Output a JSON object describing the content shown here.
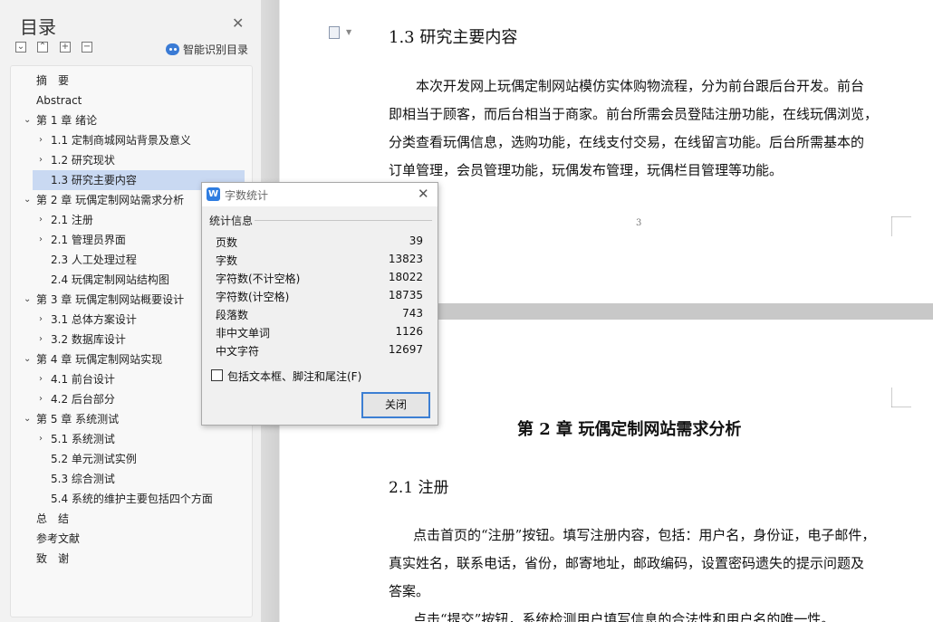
{
  "toc": {
    "title": "目录",
    "smart_label": "智能识别目录",
    "toolbar": [
      "⌄",
      "⌃",
      "+",
      "−"
    ],
    "items": [
      {
        "label": "摘　要",
        "caret": ""
      },
      {
        "label": "Abstract",
        "caret": ""
      },
      {
        "label": "第 1 章  绪论",
        "caret": "⌄"
      },
      {
        "label": "1.1  定制商城网站背景及意义",
        "caret": "›"
      },
      {
        "label": "1.2 研究现状",
        "caret": "›"
      },
      {
        "label": "1.3  研究主要内容",
        "caret": ""
      },
      {
        "label": "第 2 章  玩偶定制网站需求分析",
        "caret": "⌄"
      },
      {
        "label": "2.1 注册",
        "caret": "›"
      },
      {
        "label": "2.1 管理员界面",
        "caret": "›"
      },
      {
        "label": "2.3 人工处理过程",
        "caret": ""
      },
      {
        "label": "2.4 玩偶定制网站结构图",
        "caret": ""
      },
      {
        "label": "第 3 章  玩偶定制网站概要设计",
        "caret": "⌄"
      },
      {
        "label": "3.1 总体方案设计",
        "caret": "›"
      },
      {
        "label": "3.2  数据库设计",
        "caret": "›"
      },
      {
        "label": "第 4 章  玩偶定制网站实现",
        "caret": "⌄"
      },
      {
        "label": "4.1  前台设计",
        "caret": "›"
      },
      {
        "label": "4.2  后台部分",
        "caret": "›"
      },
      {
        "label": "第 5 章  系统测试",
        "caret": "⌄"
      },
      {
        "label": "5.1 系统测试",
        "caret": "›"
      },
      {
        "label": "5.2 单元测试实例",
        "caret": ""
      },
      {
        "label": "5.3 综合测试",
        "caret": ""
      },
      {
        "label": "5.4 系统的维护主要包括四个方面",
        "caret": ""
      },
      {
        "label": "总　结",
        "caret": ""
      },
      {
        "label": "参考文献",
        "caret": ""
      },
      {
        "label": "致　谢",
        "caret": ""
      }
    ]
  },
  "document": {
    "page1": {
      "heading": "1.3  研究主要内容",
      "lines": [
        "本次开发网上玩偶定制网站模仿实体购物流程，分为前台跟后台开发。前台",
        "即相当于顾客，而后台相当于商家。前台所需会员登陆注册功能，在线玩偶浏览，",
        "分类查看玩偶信息，选购功能，在线支付交易，在线留言功能。后台所需基本的",
        "订单管理，会员管理功能，玩偶发布管理，玩偶栏目管理等功能。"
      ],
      "page_number": "3"
    },
    "page2": {
      "chapter": "第 2 章  玩偶定制网站需求分析",
      "section": "2.1 注册",
      "lines": [
        "点击首页的“注册”按钮。填写注册内容，包括：用户名，身份证，电子邮件，",
        "真实姓名，联系电话，省份，邮寄地址，邮政编码，设置密码遗失的提示问题及",
        "答案。",
        "点击“提交”按钮，系统检测用户填写信息的合法性和用户名的唯一性。"
      ]
    }
  },
  "dialog": {
    "title": "字数统计",
    "section_label": "统计信息",
    "stats": [
      {
        "label": "页数",
        "value": "39"
      },
      {
        "label": "字数",
        "value": "13823"
      },
      {
        "label": "字符数(不计空格)",
        "value": "18022"
      },
      {
        "label": "字符数(计空格)",
        "value": "18735"
      },
      {
        "label": "段落数",
        "value": "743"
      },
      {
        "label": "非中文单词",
        "value": "1126"
      },
      {
        "label": "中文字符",
        "value": "12697"
      }
    ],
    "checkbox_label": "包括文本框、脚注和尾注(F)",
    "close_button": "关闭"
  },
  "colors": {
    "accent": "#3c7fd3",
    "toc_active": "#c9d9f2"
  }
}
